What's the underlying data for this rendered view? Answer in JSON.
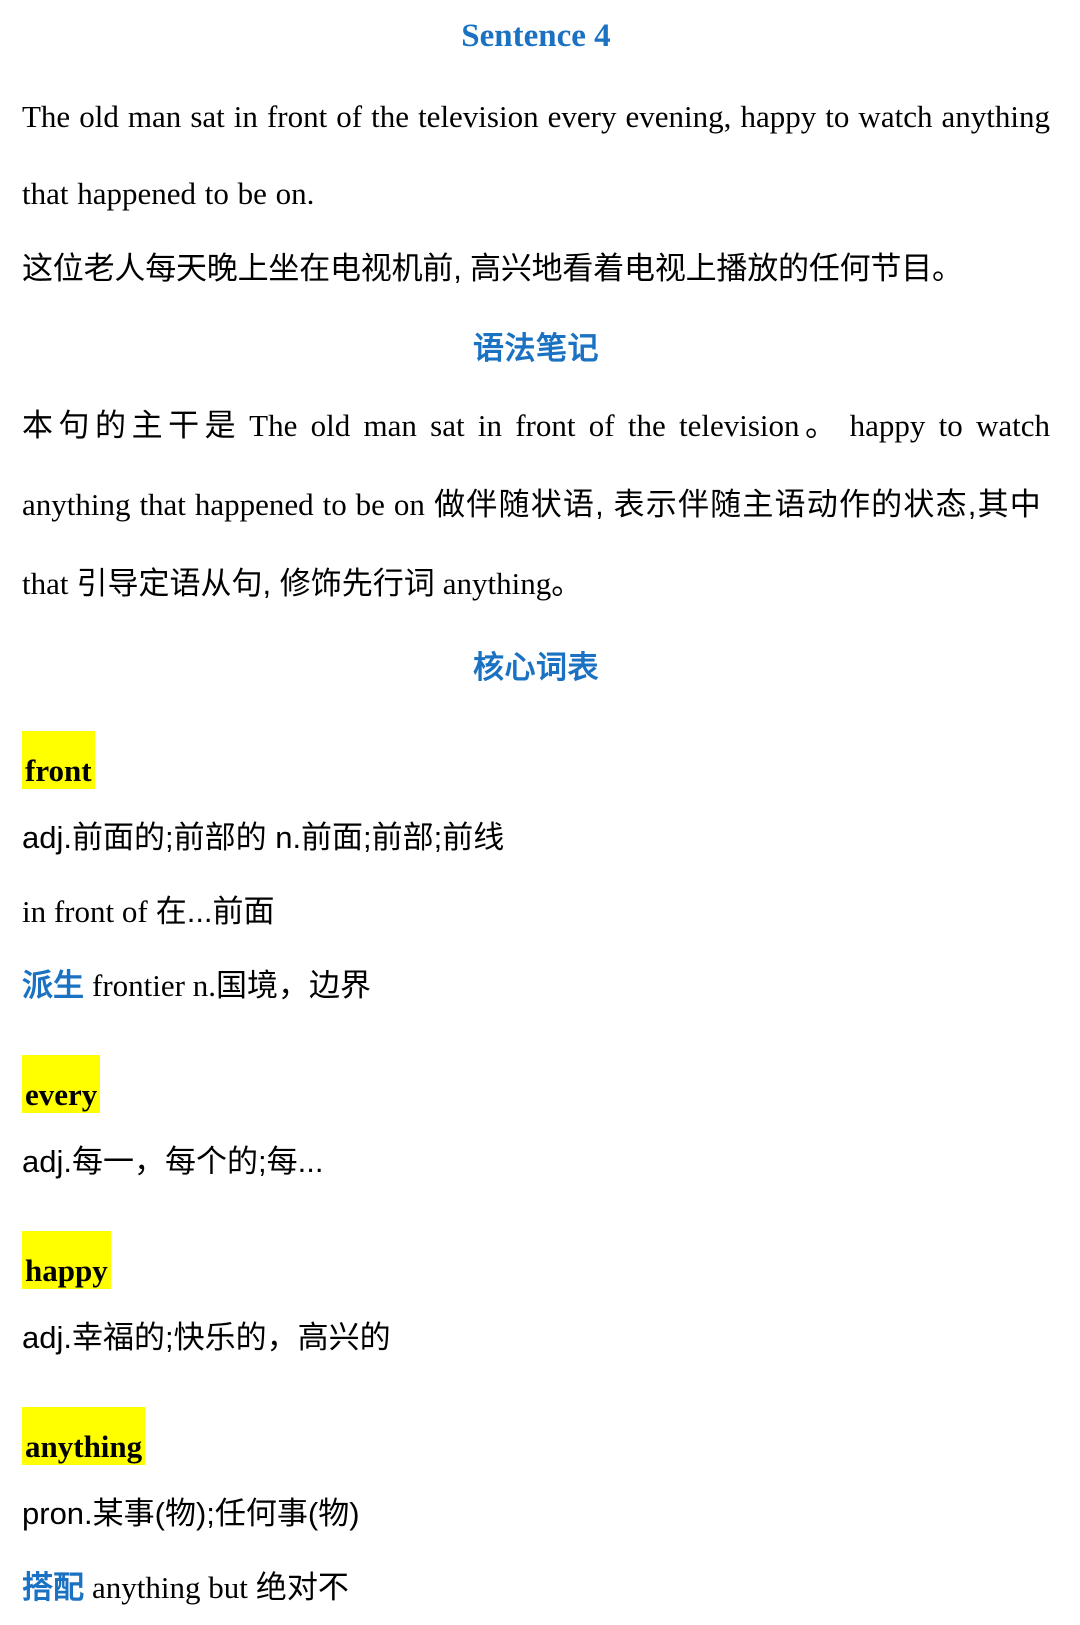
{
  "colors": {
    "heading_blue": "#1b72c2",
    "highlight_yellow": "#ffff00",
    "text_black": "#000000",
    "background": "#ffffff"
  },
  "title": "Sentence 4",
  "sentence": {
    "english": "The old man sat in front of the television every evening, happy to watch anything that happened to be on.",
    "chinese": "这位老人每天晚上坐在电视机前, 高兴地看着电视上播放的任何节目。"
  },
  "grammar_section": {
    "heading": "语法笔记",
    "note_parts": {
      "p1_cn": "本句的主干是",
      "p2_en": "The old man sat in front of the television",
      "p3_cn": "。",
      "p4_en": "happy to watch anything that happened to be on",
      "p5_cn": "做伴随状语, 表示伴随主语动作的状态,其中",
      "p6_en": "that",
      "p7_cn": "引导定语从句, 修饰先行词",
      "p8_en": "anything",
      "p9_cn": "。"
    }
  },
  "wordlist_section": {
    "heading": "核心词表",
    "entries": [
      {
        "headword": "front",
        "definition": "adj.前面的;前部的 n.前面;前部;前线",
        "extras": [
          {
            "tag": "",
            "en": "in front of",
            "cn": "在...前面"
          },
          {
            "tag": "派生",
            "en": "frontier n.",
            "cn": "国境，边界"
          }
        ]
      },
      {
        "headword": "every",
        "definition": "adj.每一，每个的;每...",
        "extras": []
      },
      {
        "headword": "happy",
        "definition": "adj.幸福的;快乐的，高兴的",
        "extras": []
      },
      {
        "headword": "anything",
        "definition": "pron.某事(物);任何事(物)",
        "extras": [
          {
            "tag": "搭配",
            "en": "anything but",
            "cn": "绝对不"
          }
        ]
      }
    ]
  }
}
